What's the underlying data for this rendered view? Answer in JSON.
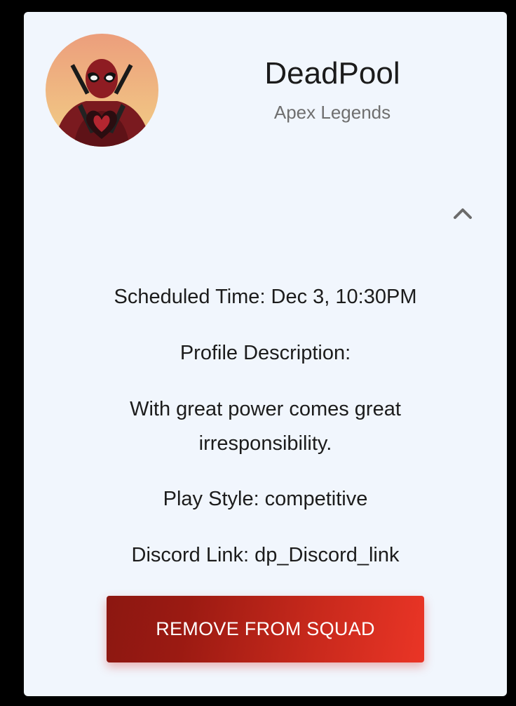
{
  "profile": {
    "name": "DeadPool",
    "game": "Apex Legends",
    "avatar_icon": "deadpool-avatar"
  },
  "details": {
    "scheduled_time": "Scheduled Time: Dec 3, 10:30PM",
    "description_label": "Profile Description:",
    "description_line1": "With great power comes great",
    "description_line2": "irresponsibility.",
    "play_style": "Play Style: competitive",
    "discord_link": "Discord Link: dp_Discord_link"
  },
  "actions": {
    "collapse_icon": "chevron-up-icon",
    "remove_label": "REMOVE FROM SQUAD"
  },
  "colors": {
    "card_bg": "#f1f6fd",
    "button_start": "#8c1711",
    "button_end": "#ea3526"
  }
}
